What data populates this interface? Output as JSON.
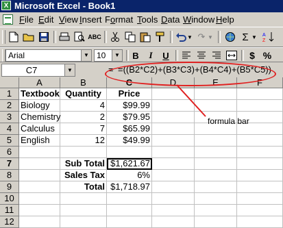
{
  "window": {
    "title": "Microsoft Excel - Book1"
  },
  "menu": [
    {
      "pre": "",
      "ul": "F",
      "post": "ile"
    },
    {
      "pre": "",
      "ul": "E",
      "post": "dit"
    },
    {
      "pre": "",
      "ul": "V",
      "post": "iew"
    },
    {
      "pre": "",
      "ul": "I",
      "post": "nsert"
    },
    {
      "pre": "F",
      "ul": "o",
      "post": "rmat"
    },
    {
      "pre": "",
      "ul": "T",
      "post": "ools"
    },
    {
      "pre": "",
      "ul": "D",
      "post": "ata"
    },
    {
      "pre": "",
      "ul": "W",
      "post": "indow"
    },
    {
      "pre": "",
      "ul": "H",
      "post": "elp"
    }
  ],
  "format_bar": {
    "font": "Arial",
    "size": "10",
    "bold": "B",
    "italic": "I",
    "underline": "U",
    "currency": "$",
    "percent": "%"
  },
  "formula_bar": {
    "name_box": "C7",
    "equals": "=",
    "formula": "=((B2*C2)+(B3*C3)+(B4*C4)+(B5*C5))"
  },
  "columns": [
    "A",
    "B",
    "C",
    "D",
    "E",
    "F"
  ],
  "rows": [
    "1",
    "2",
    "3",
    "4",
    "5",
    "6",
    "7",
    "8",
    "9",
    "10",
    "11",
    "12"
  ],
  "cells": {
    "A1": "Textbook",
    "B1": "Quantity",
    "C1": "Price",
    "A2": "Biology",
    "B2": "4",
    "C2": "$99.99",
    "A3": "Chemistry",
    "B3": "2",
    "C3": "$79.95",
    "A4": "Calculus",
    "B4": "7",
    "C4": "$65.99",
    "A5": "English",
    "B5": "12",
    "C5": "$49.99",
    "B7": "Sub Total",
    "C7": "$1,621.67",
    "B8": "Sales Tax",
    "C8": "6%",
    "B9": "Total",
    "C9": "$1,718.97"
  },
  "annotation": {
    "label": "formula bar",
    "color": "#e02020"
  }
}
